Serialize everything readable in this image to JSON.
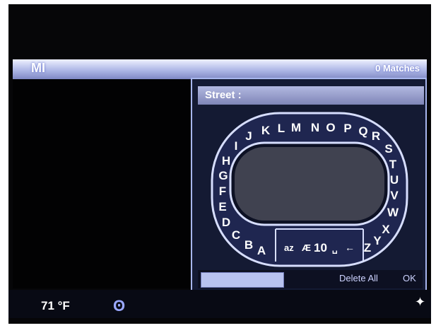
{
  "header": {
    "state": "MI",
    "matches": "0 Matches"
  },
  "entry": {
    "field_label": "Street :"
  },
  "keyboard": {
    "letters": [
      "A",
      "B",
      "C",
      "D",
      "E",
      "F",
      "G",
      "H",
      "I",
      "J",
      "K",
      "L",
      "M",
      "N",
      "O",
      "P",
      "Q",
      "R",
      "S",
      "T",
      "U",
      "V",
      "W",
      "X",
      "Y",
      "Z"
    ],
    "center_controls": [
      "az",
      "Æ",
      "10",
      "␣",
      "←"
    ]
  },
  "softkeys": {
    "left": "",
    "delete_all": "Delete All",
    "ok": "OK"
  },
  "status": {
    "temperature": "71 °F",
    "bluetooth_icon": "bluetooth-icon",
    "nav_icon": "navigation-icon"
  }
}
